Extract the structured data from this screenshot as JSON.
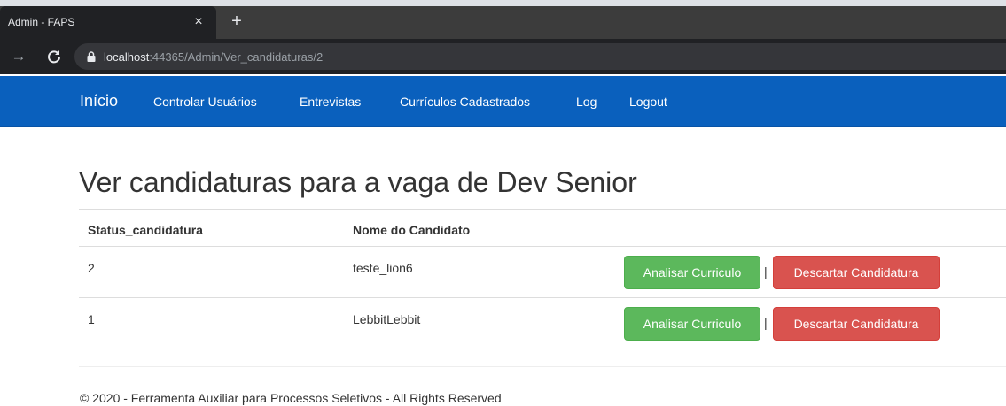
{
  "browser": {
    "tab_title": "Admin - FAPS",
    "tab_close_glyph": "×",
    "new_tab_glyph": "+",
    "back_glyph": "→",
    "reload_glyph": "C",
    "url_host": "localhost",
    "url_rest": ":44365/Admin/Ver_candidaturas/2"
  },
  "navbar": {
    "brand": "Início",
    "links": [
      "Controlar Usuários",
      "Entrevistas",
      "Currículos Cadastrados",
      "Log",
      "Logout"
    ],
    "color": "#0a60bd"
  },
  "page": {
    "title": "Ver candidaturas para a vaga de Dev Senior"
  },
  "table": {
    "headers": [
      "Status_candidatura",
      "Nome do Candidato"
    ],
    "rows": [
      {
        "status": "2",
        "name": "teste_lion6",
        "analyze_label": "Analisar Curriculo",
        "separator": "|",
        "discard_label": "Descartar Candidatura"
      },
      {
        "status": "1",
        "name": "LebbitLebbit",
        "analyze_label": "Analisar Curriculo",
        "separator": "|",
        "discard_label": "Descartar Candidatura"
      }
    ]
  },
  "footer": {
    "text": "© 2020 - Ferramenta Auxiliar para Processos Seletivos - All Rights Reserved"
  },
  "colors": {
    "success": "#5cb85c",
    "danger": "#d9534f"
  }
}
